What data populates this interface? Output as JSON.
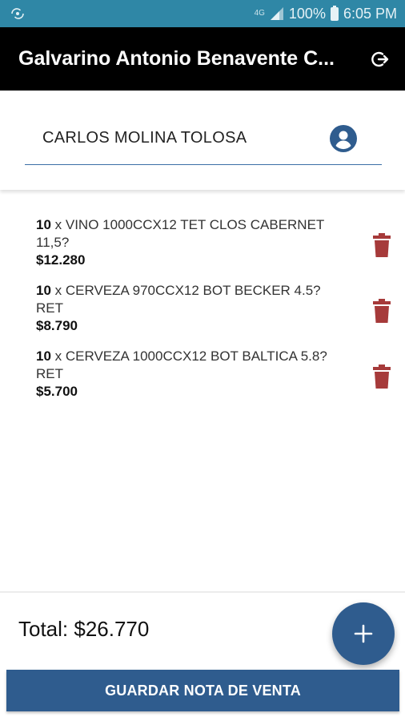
{
  "status_bar": {
    "network": "4G",
    "battery": "100%",
    "time": "6:05 PM",
    "notification_icon": "sync-icon"
  },
  "app_bar": {
    "title": "Galvarino Antonio Benavente C...",
    "action_icon": "logout-icon"
  },
  "client": {
    "name": "CARLOS MOLINA TOLOSA",
    "icon": "person-icon",
    "accent_color": "#3b6fa6"
  },
  "items": [
    {
      "qty": "10",
      "separator": " x ",
      "description": "VINO 1000CCX12 TET CLOS CABERNET 11,5?",
      "price": "$12.280"
    },
    {
      "qty": "10",
      "separator": " x ",
      "description": "CERVEZA 970CCX12 BOT BECKER 4.5? RET",
      "price": "$8.790"
    },
    {
      "qty": "10",
      "separator": " x ",
      "description": "CERVEZA 1000CCX12 BOT BALTICA 5.8? RET",
      "price": "$5.700"
    }
  ],
  "total": {
    "label": "Total: $26.770"
  },
  "actions": {
    "add_icon": "plus-icon",
    "save_label": "GUARDAR NOTA DE VENTA",
    "primary_color": "#2f5c8e",
    "delete_color": "#a63a3a"
  }
}
